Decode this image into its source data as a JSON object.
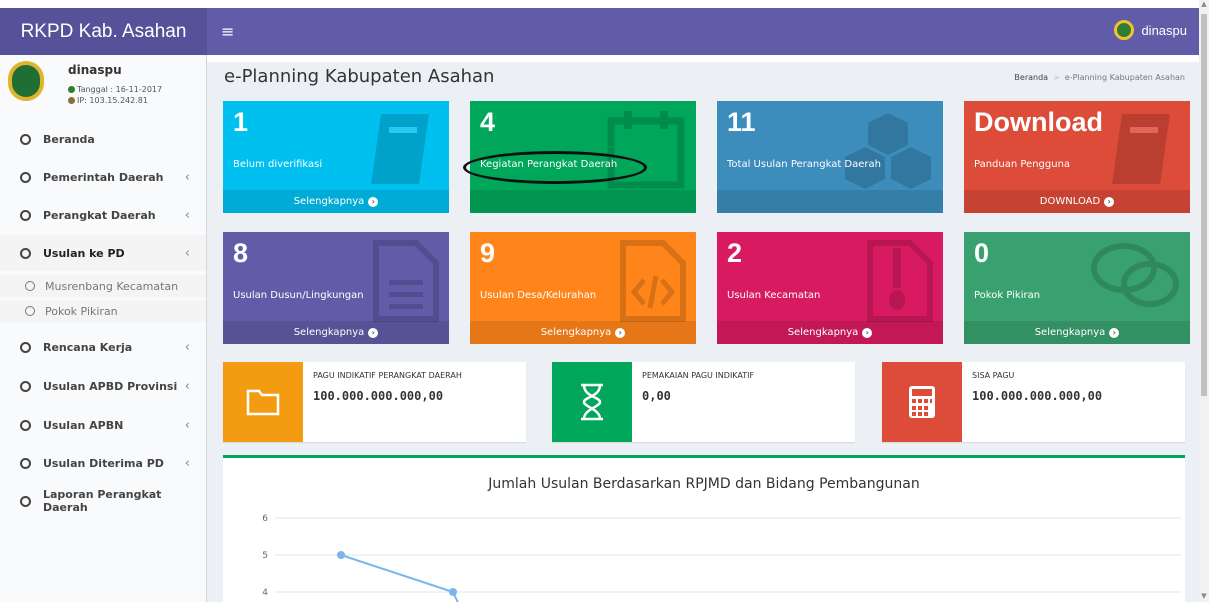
{
  "app": {
    "brand": "RKPD Kab. Asahan",
    "toggle_icon": "hamburger-icon",
    "nav_user": "dinaspu"
  },
  "user_panel": {
    "name": "dinaspu",
    "date": "Tanggal : 16-11-2017",
    "ip": "IP: 103.15.242.81",
    "date_color": "#2e7d32",
    "ip_color": "#8a6d3b"
  },
  "menu": [
    {
      "label": "Beranda",
      "chevron": ""
    },
    {
      "label": "Pemerintah Daerah",
      "chevron": "‹"
    },
    {
      "label": "Perangkat Daerah",
      "chevron": "‹"
    },
    {
      "label": "Usulan ke PD",
      "chevron": "‹"
    },
    {
      "label": "Rencana Kerja",
      "chevron": "‹"
    },
    {
      "label": "Usulan APBD Provinsi",
      "chevron": "‹"
    },
    {
      "label": "Usulan APBN",
      "chevron": "‹"
    },
    {
      "label": "Usulan Diterima PD",
      "chevron": "‹"
    },
    {
      "label": "Laporan Perangkat Daerah",
      "chevron": ""
    }
  ],
  "submenu": [
    "Musrenbang Kecamatan",
    "Pokok Pikiran"
  ],
  "header": {
    "title": "e-Planning Kabupaten Asahan",
    "breadcrumb_home": "Beranda",
    "breadcrumb_sep": ">",
    "breadcrumb_current": "e-Planning Kabupaten Asahan"
  },
  "boxes": [
    {
      "num": "1",
      "label": "Belum diverifikasi",
      "footer": "Selengkapnya",
      "color": "#00c0ef",
      "icon": "book-icon"
    },
    {
      "num": "4",
      "label": "Kegiatan Perangkat Daerah",
      "footer": "",
      "color": "#00a65a",
      "icon": "calendar-icon"
    },
    {
      "num": "11",
      "label": "Total Usulan Perangkat Daerah",
      "footer": "",
      "color": "#3c8dbc",
      "icon": "cubes-icon"
    },
    {
      "num": "Download",
      "label": "Panduan Pengguna",
      "footer": "DOWNLOAD",
      "color": "#dd4b39",
      "icon": "book-icon"
    },
    {
      "num": "8",
      "label": "Usulan Dusun/Lingkungan",
      "footer": "Selengkapnya",
      "color": "#605ca8",
      "icon": "file-text-icon"
    },
    {
      "num": "9",
      "label": "Usulan Desa/Kelurahan",
      "footer": "Selengkapnya",
      "color": "#ff851b",
      "icon": "file-code-icon"
    },
    {
      "num": "2",
      "label": "Usulan Kecamatan",
      "footer": "Selengkapnya",
      "color": "#d81b60",
      "icon": "file-zip-icon"
    },
    {
      "num": "0",
      "label": "Pokok Pikiran",
      "footer": "Selengkapnya",
      "color": "#39a16f",
      "icon": "comments-icon"
    }
  ],
  "info_boxes": [
    {
      "title": "PAGU INDIKATIF PERANGKAT DAERAH",
      "value": "100.000.000.000,00",
      "color": "#f39c12",
      "icon": "folder-icon"
    },
    {
      "title": "PEMAKAIAN PAGU INDIKATIF",
      "value": "0,00",
      "color": "#00a65a",
      "icon": "hourglass-icon"
    },
    {
      "title": "SISA PAGU",
      "value": "100.000.000.000,00",
      "color": "#dd4b39",
      "icon": "calculator-icon"
    }
  ],
  "chart_data": {
    "type": "line",
    "title": "Jumlah Usulan Berdasarkan RPJMD dan Bidang Pembangunan",
    "y_ticks": [
      "6",
      "5",
      "4"
    ],
    "ylim": [
      4,
      6
    ],
    "series": [
      {
        "values": [
          5,
          4
        ]
      }
    ],
    "color": "#7cb5ec",
    "grid": true
  }
}
